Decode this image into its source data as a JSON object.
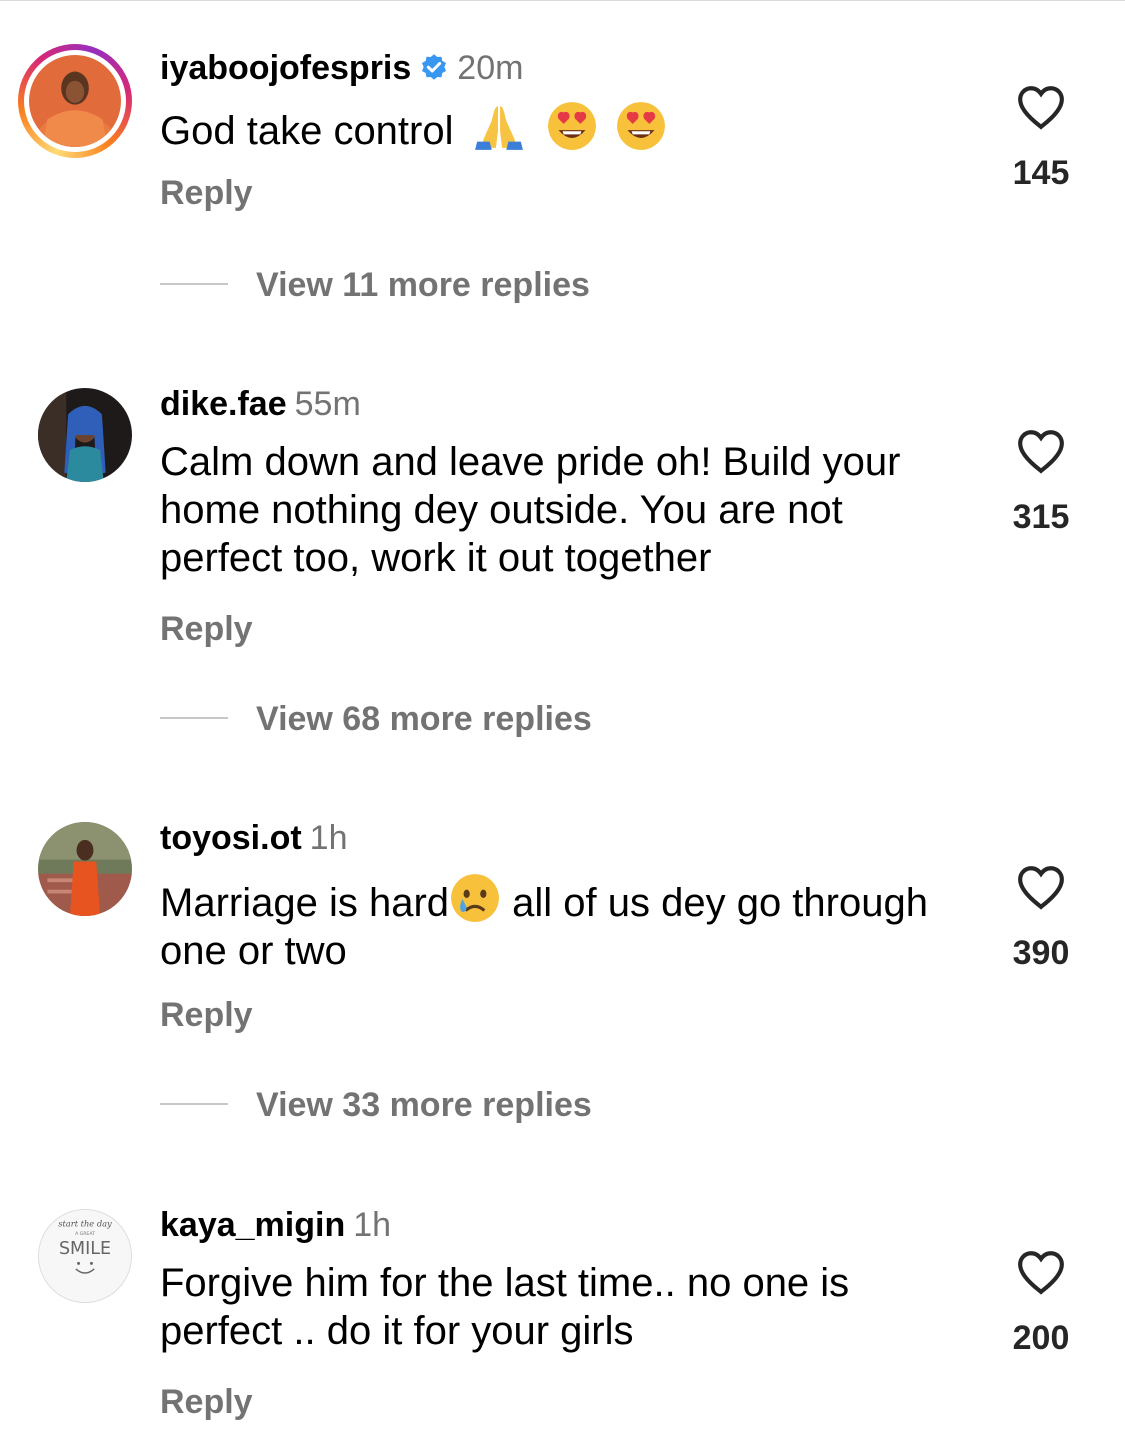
{
  "comments": [
    {
      "username": "iyaboojofespris",
      "verified": true,
      "time": "20m",
      "text": "God take control",
      "emojis": [
        "folded-hands",
        "heart-eyes",
        "heart-eyes"
      ],
      "reply": "Reply",
      "likes": "145",
      "view_replies": "View 11 more replies"
    },
    {
      "username": "dike.fae",
      "time": "55m",
      "text": "Calm down and leave pride oh! Build your home nothing dey outside. You are not perfect too, work it out together",
      "reply": "Reply",
      "likes": "315",
      "view_replies": "View 68 more replies"
    },
    {
      "username": "toyosi.ot",
      "time": "1h",
      "text_before": "Marriage is hard",
      "text_after": " all of us dey go through one or two",
      "emoji": "crying-face",
      "reply": "Reply",
      "likes": "390",
      "view_replies": "View 33 more replies"
    },
    {
      "username": "kaya_migin",
      "time": "1h",
      "text": "Forgive him for the last time.. no one is perfect .. do it for your girls",
      "reply": "Reply",
      "likes": "200",
      "avatar_text": "SMILE"
    }
  ],
  "colors": {
    "secondary_text": "#737373",
    "verified_blue": "#3897f0",
    "divider": "#c7c7c7"
  }
}
